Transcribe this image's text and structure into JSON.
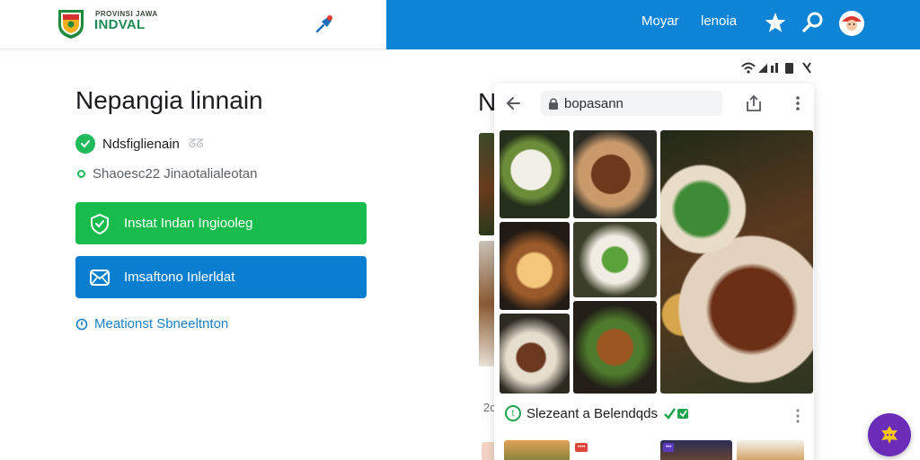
{
  "header": {
    "brand_top": "PROVINSI JAWA",
    "brand_name": "INDVAL",
    "nav": [
      "Moyar",
      "lenoia"
    ],
    "icons": [
      "pin-icon",
      "star-icon",
      "search-icon",
      "avatar"
    ],
    "accent": "#0d84d6"
  },
  "main": {
    "title": "Nepangia linnain",
    "verified_label": "Ndsfiglienain",
    "verified_badge": "ᘔᘔ",
    "subline": "Shaoesc22 Jinaotalialeotan",
    "install_button": "Instat Indan Ingiooleg",
    "info_button": "Imsaftono Inlerldat",
    "more_link": "Meationst Sbneeltnton"
  },
  "behind": {
    "title_fragment": "N",
    "bottom_fragment": "2c"
  },
  "browser_card": {
    "url": "bopasann",
    "caption": "Slezeant a Belendqds",
    "thumb_badges": [
      "••••",
      "•••"
    ]
  },
  "colors": {
    "green": "#17bc4c",
    "blue": "#0a7fcf",
    "fab": "#6b2db8"
  }
}
